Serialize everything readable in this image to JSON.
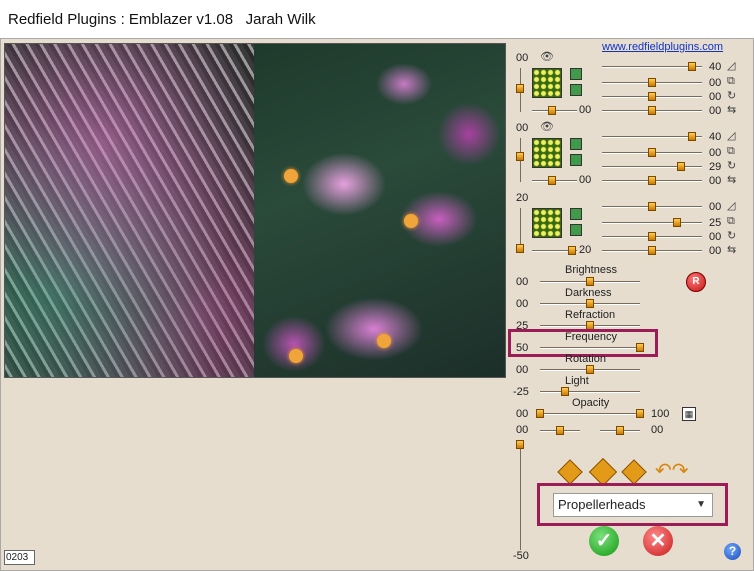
{
  "window": {
    "title": "Redfield Plugins : Emblazer v1.08   Jarah Wilk"
  },
  "link": "www.redfieldplugins.com",
  "counter": "0203",
  "layers": [
    {
      "left_value": "00",
      "left_bottom_value": "00",
      "values": [
        "40",
        "00",
        "00",
        "00"
      ]
    },
    {
      "left_value": "00",
      "left_bottom_value": "00",
      "values": [
        "40",
        "00",
        "29",
        "00"
      ]
    },
    {
      "left_value": "20",
      "left_bottom_value": "20",
      "values": [
        "00",
        "25",
        "00",
        "00"
      ]
    }
  ],
  "params": [
    {
      "label": "Brightness",
      "value": "00"
    },
    {
      "label": "Darkness",
      "value": "00"
    },
    {
      "label": "Refraction",
      "value": "25"
    },
    {
      "label": "Frequency",
      "value": "50"
    },
    {
      "label": "Rotation",
      "value": "00"
    },
    {
      "label": "Light",
      "value": "-25"
    },
    {
      "label": "Opacity",
      "value_left": "00",
      "value_right": "100"
    }
  ],
  "extra_row": {
    "left": "00",
    "right": "00"
  },
  "vertical_slider": {
    "bottom_value": "-50"
  },
  "reset_button": "R",
  "preset": {
    "selected": "Propellerheads"
  },
  "buttons": {
    "ok": "✓",
    "cancel": "✕",
    "help": "?"
  }
}
